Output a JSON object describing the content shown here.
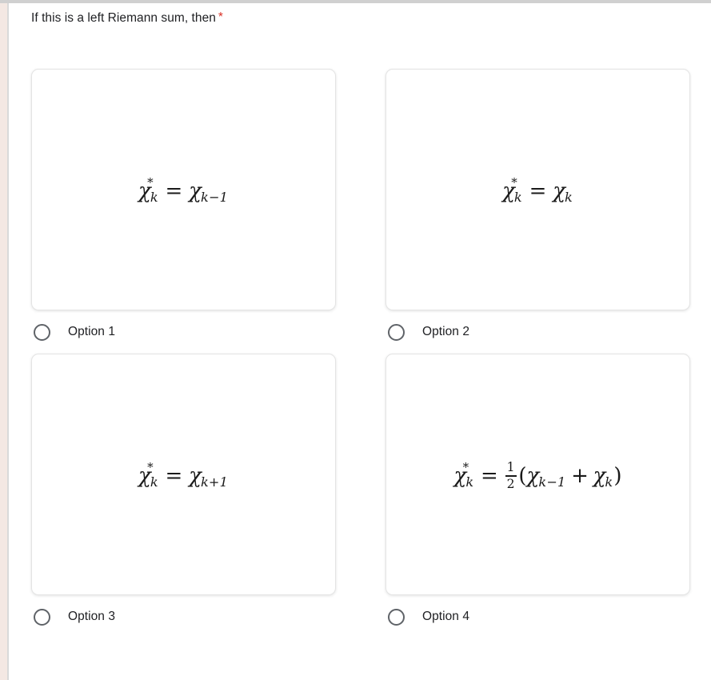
{
  "question": {
    "text": "If this is a left Riemann sum, then",
    "required_marker": "*",
    "required_color": "#d93025"
  },
  "options": [
    {
      "label": "Option 1",
      "formula_plain": "x*_k = x_(k-1)",
      "lhs": {
        "base": "χ",
        "star": "*",
        "sub": "k"
      },
      "rhs": {
        "base": "χ",
        "sub": "k−1"
      },
      "relation": "=",
      "selected": false
    },
    {
      "label": "Option 2",
      "formula_plain": "x*_k = x_k",
      "lhs": {
        "base": "χ",
        "star": "*",
        "sub": "k"
      },
      "rhs": {
        "base": "χ",
        "sub": "k"
      },
      "relation": "=",
      "selected": false
    },
    {
      "label": "Option 3",
      "formula_plain": "x*_k = x_(k+1)",
      "lhs": {
        "base": "χ",
        "star": "*",
        "sub": "k"
      },
      "rhs": {
        "base": "χ",
        "sub": "k+1"
      },
      "relation": "=",
      "selected": false
    },
    {
      "label": "Option 4",
      "formula_plain": "x*_k = 1/2 (x_(k-1) + x_k)",
      "lhs": {
        "base": "χ",
        "star": "*",
        "sub": "k"
      },
      "relation": "=",
      "fraction": {
        "numerator": "1",
        "denominator": "2"
      },
      "open_paren": "(",
      "term1": {
        "base": "χ",
        "sub": "k−1"
      },
      "operator": "+",
      "term2": {
        "base": "χ",
        "sub": "k"
      },
      "close_paren": ")"
    }
  ]
}
